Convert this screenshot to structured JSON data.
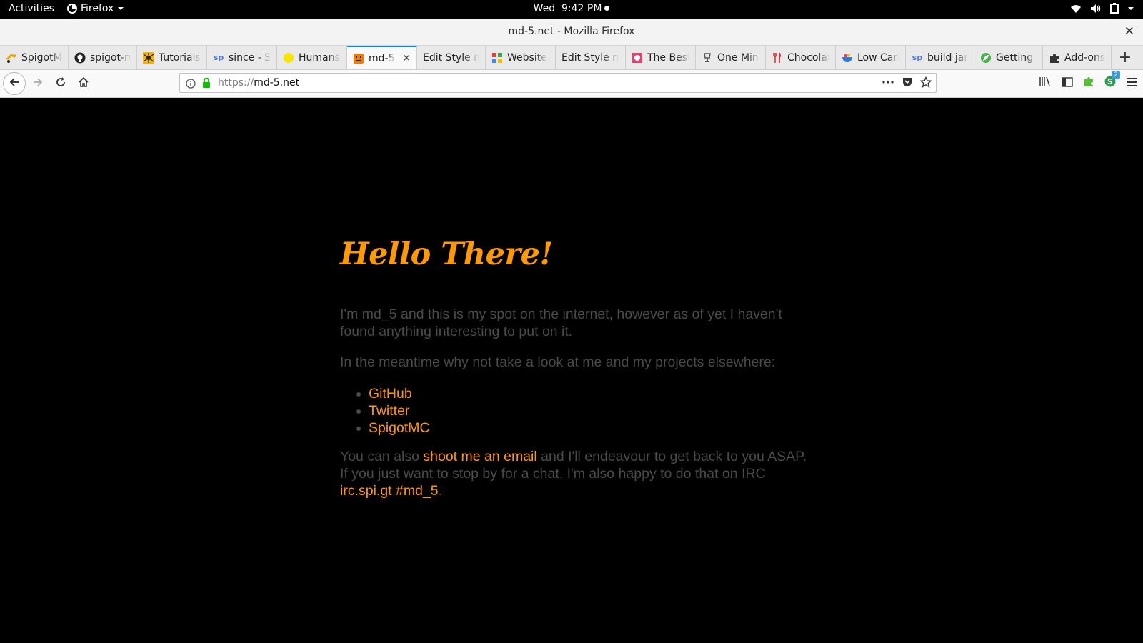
{
  "topbar": {
    "activities": "Activities",
    "app_name": "Firefox",
    "day": "Wed",
    "time": "9:42 PM"
  },
  "window": {
    "title": "md-5.net - Mozilla Firefox"
  },
  "tabs": [
    {
      "label": "SpigotMC",
      "icon": "spigot-tap-icon"
    },
    {
      "label": "spigot-restapi",
      "icon": "github-icon"
    },
    {
      "label": "Tutorials",
      "icon": "spider-icon"
    },
    {
      "label": "since - Spigot",
      "icon": "spigot-sp-icon"
    },
    {
      "label": "Humans",
      "icon": "yellow-circle-icon"
    },
    {
      "label": "md-5",
      "icon": "md5-face-icon",
      "active": true
    },
    {
      "label": "Edit Style m",
      "icon": ""
    },
    {
      "label": "Website",
      "icon": "colorful-squares-icon"
    },
    {
      "label": "Edit Style m",
      "icon": ""
    },
    {
      "label": "The Best",
      "icon": "recipe-icon"
    },
    {
      "label": "One Minute",
      "icon": "trophy-icon"
    },
    {
      "label": "Chocolate",
      "icon": "fork-knife-icon"
    },
    {
      "label": "Low Carb",
      "icon": "bowl-icon"
    },
    {
      "label": "build jar",
      "icon": "spigot-sp-icon"
    },
    {
      "label": "Getting Started",
      "icon": "leaf-icon"
    },
    {
      "label": "Add-ons",
      "icon": "puzzle-icon"
    }
  ],
  "navbar": {
    "url_scheme": "https://",
    "url_host": "md-5.net",
    "stylus_badge": "2"
  },
  "page": {
    "heading": "Hello There!",
    "intro": "I'm md_5 and this is my spot on the internet, however as of yet I haven't found anything interesting to put on it.",
    "meantime": "In the meantime why not take a look at me and my projects elsewhere:",
    "links": [
      "GitHub",
      "Twitter",
      "SpigotMC"
    ],
    "contact_prefix": "You can also ",
    "email_link": "shoot me an email",
    "contact_middle": " and I'll endeavour to get back to you ASAP. If you just want to stop by for a chat, I'm also happy to do that on IRC ",
    "irc_link": "irc.spi.gt #md_5",
    "contact_suffix": "."
  },
  "colors": {
    "accent": "#ff9900",
    "body_text": "#4a4a4a",
    "background": "#000000",
    "tab_highlight": "#0a84ff"
  }
}
